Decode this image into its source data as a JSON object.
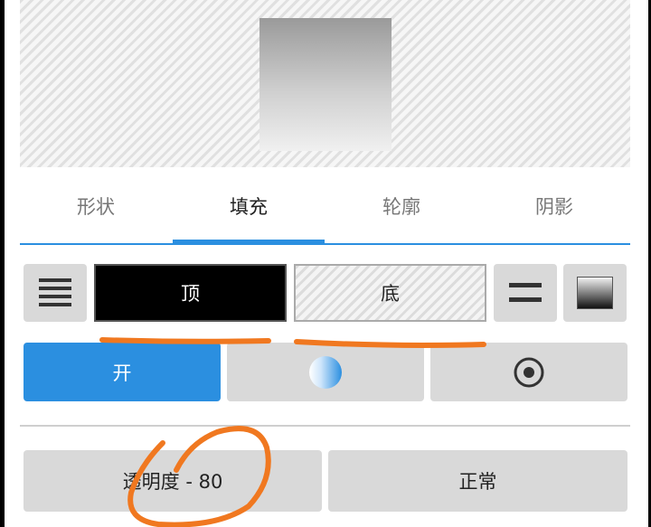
{
  "tabs": [
    {
      "label": "形状"
    },
    {
      "label": "填充"
    },
    {
      "label": "轮廓"
    },
    {
      "label": "阴影"
    }
  ],
  "active_tab": "填充",
  "gradient_row": {
    "top_label": "顶",
    "bottom_label": "底",
    "top_color": "#000000",
    "left_icon": "lines-align-icon",
    "equal_icon": "equal-icon",
    "preview_icon": "gradient-swatch-icon"
  },
  "mode_row": {
    "on_label": "开",
    "on_color": "#2b8fe0",
    "sphere_icon": "sphere-gradient-icon",
    "radial_icon": "radial-target-icon"
  },
  "bottom_row": {
    "opacity_label": "透明度 - 80",
    "blend_label": "正常"
  },
  "accent_color": "#2b8fe0",
  "annotation_color": "#f07820"
}
